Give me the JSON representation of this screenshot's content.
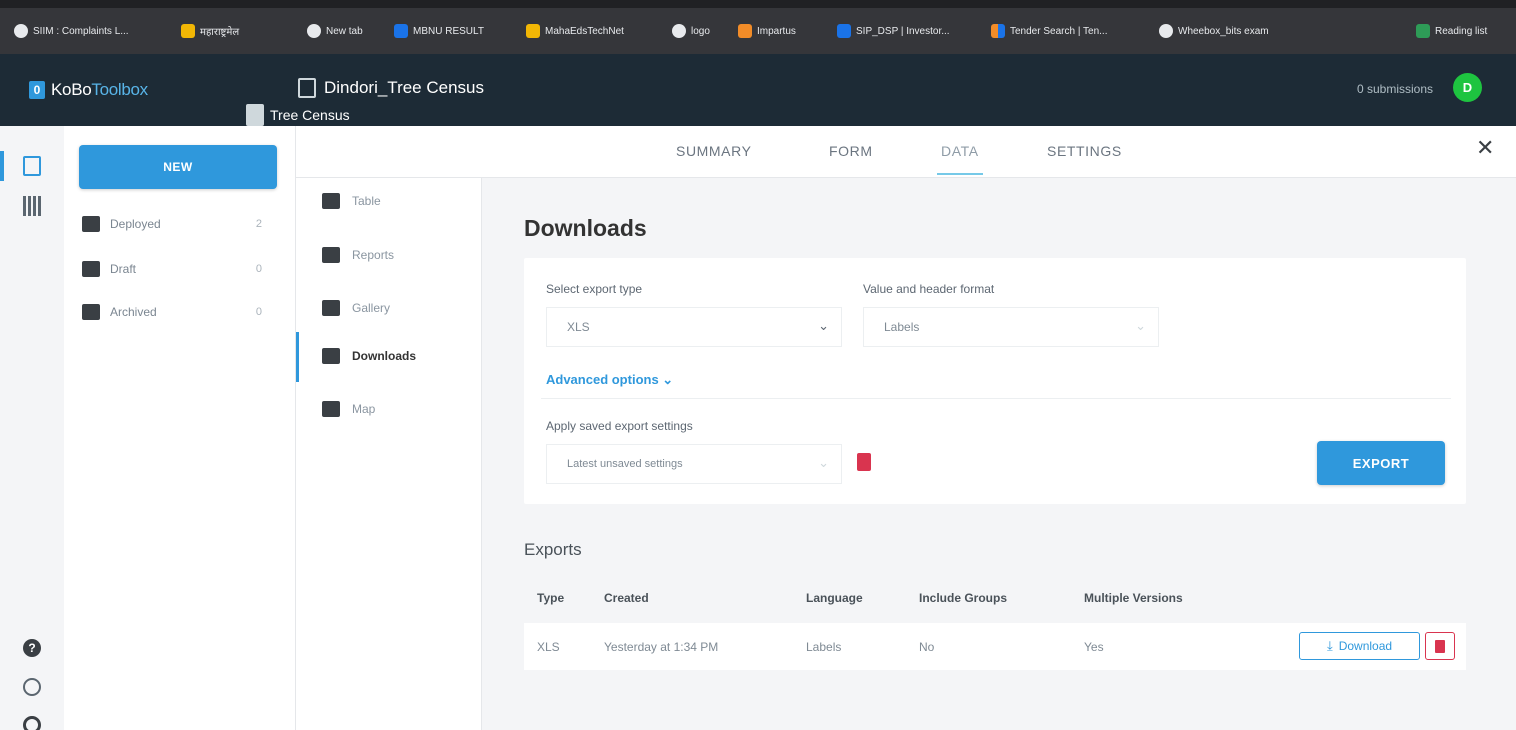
{
  "bookmarks": [
    {
      "label": "SIIM : Complaints L...",
      "icon": "globe"
    },
    {
      "label": "महाराष्ट्रमेल",
      "icon": "yellow"
    },
    {
      "label": "New tab",
      "icon": "globe"
    },
    {
      "label": "MBNU RESULT",
      "icon": "blue"
    },
    {
      "label": "MahaEdsTechNet",
      "icon": "yellow"
    },
    {
      "label": "logo",
      "icon": "globe"
    },
    {
      "label": "Impartus",
      "icon": "orange"
    },
    {
      "label": "SIP_DSP | Investor...",
      "icon": "blue"
    },
    {
      "label": "Tender Search | Ten...",
      "icon": "multi"
    },
    {
      "label": "Wheebox_bits exam",
      "icon": "globe"
    },
    {
      "label": "Reading list",
      "icon": "green"
    }
  ],
  "header": {
    "logo_bold": "KoBo",
    "logo_light": "Toolbox",
    "form_title": "Dindori_Tree Census",
    "drag_label": "Tree Census",
    "submissions": "0 submissions",
    "avatar_letter": "D"
  },
  "tabs": [
    "SUMMARY",
    "FORM",
    "DATA",
    "SETTINGS"
  ],
  "sidebar": {
    "new_label": "NEW",
    "items": [
      {
        "label": "Deployed",
        "count": "2"
      },
      {
        "label": "Draft",
        "count": "0"
      },
      {
        "label": "Archived",
        "count": "0"
      }
    ]
  },
  "subnav": [
    "Table",
    "Reports",
    "Gallery",
    "Downloads",
    "Map"
  ],
  "downloads": {
    "title": "Downloads",
    "export_type_label": "Select export type",
    "export_type_value": "XLS",
    "format_label": "Value and header format",
    "format_value": "Labels",
    "advanced": "Advanced options ⌄",
    "saved_label": "Apply saved export settings",
    "saved_value": "Latest unsaved settings",
    "export_btn": "EXPORT"
  },
  "exports": {
    "title": "Exports",
    "columns": [
      "Type",
      "Created",
      "Language",
      "Include Groups",
      "Multiple Versions"
    ],
    "rows": [
      {
        "type": "XLS",
        "created": "Yesterday at 1:34 PM",
        "language": "Labels",
        "groups": "No",
        "versions": "Yes"
      }
    ],
    "download_label": "Download"
  },
  "colors": {
    "accent": "#2f98dc",
    "header_bg": "#1d2b36",
    "danger": "#d9344f",
    "avatar": "#1ec440"
  }
}
